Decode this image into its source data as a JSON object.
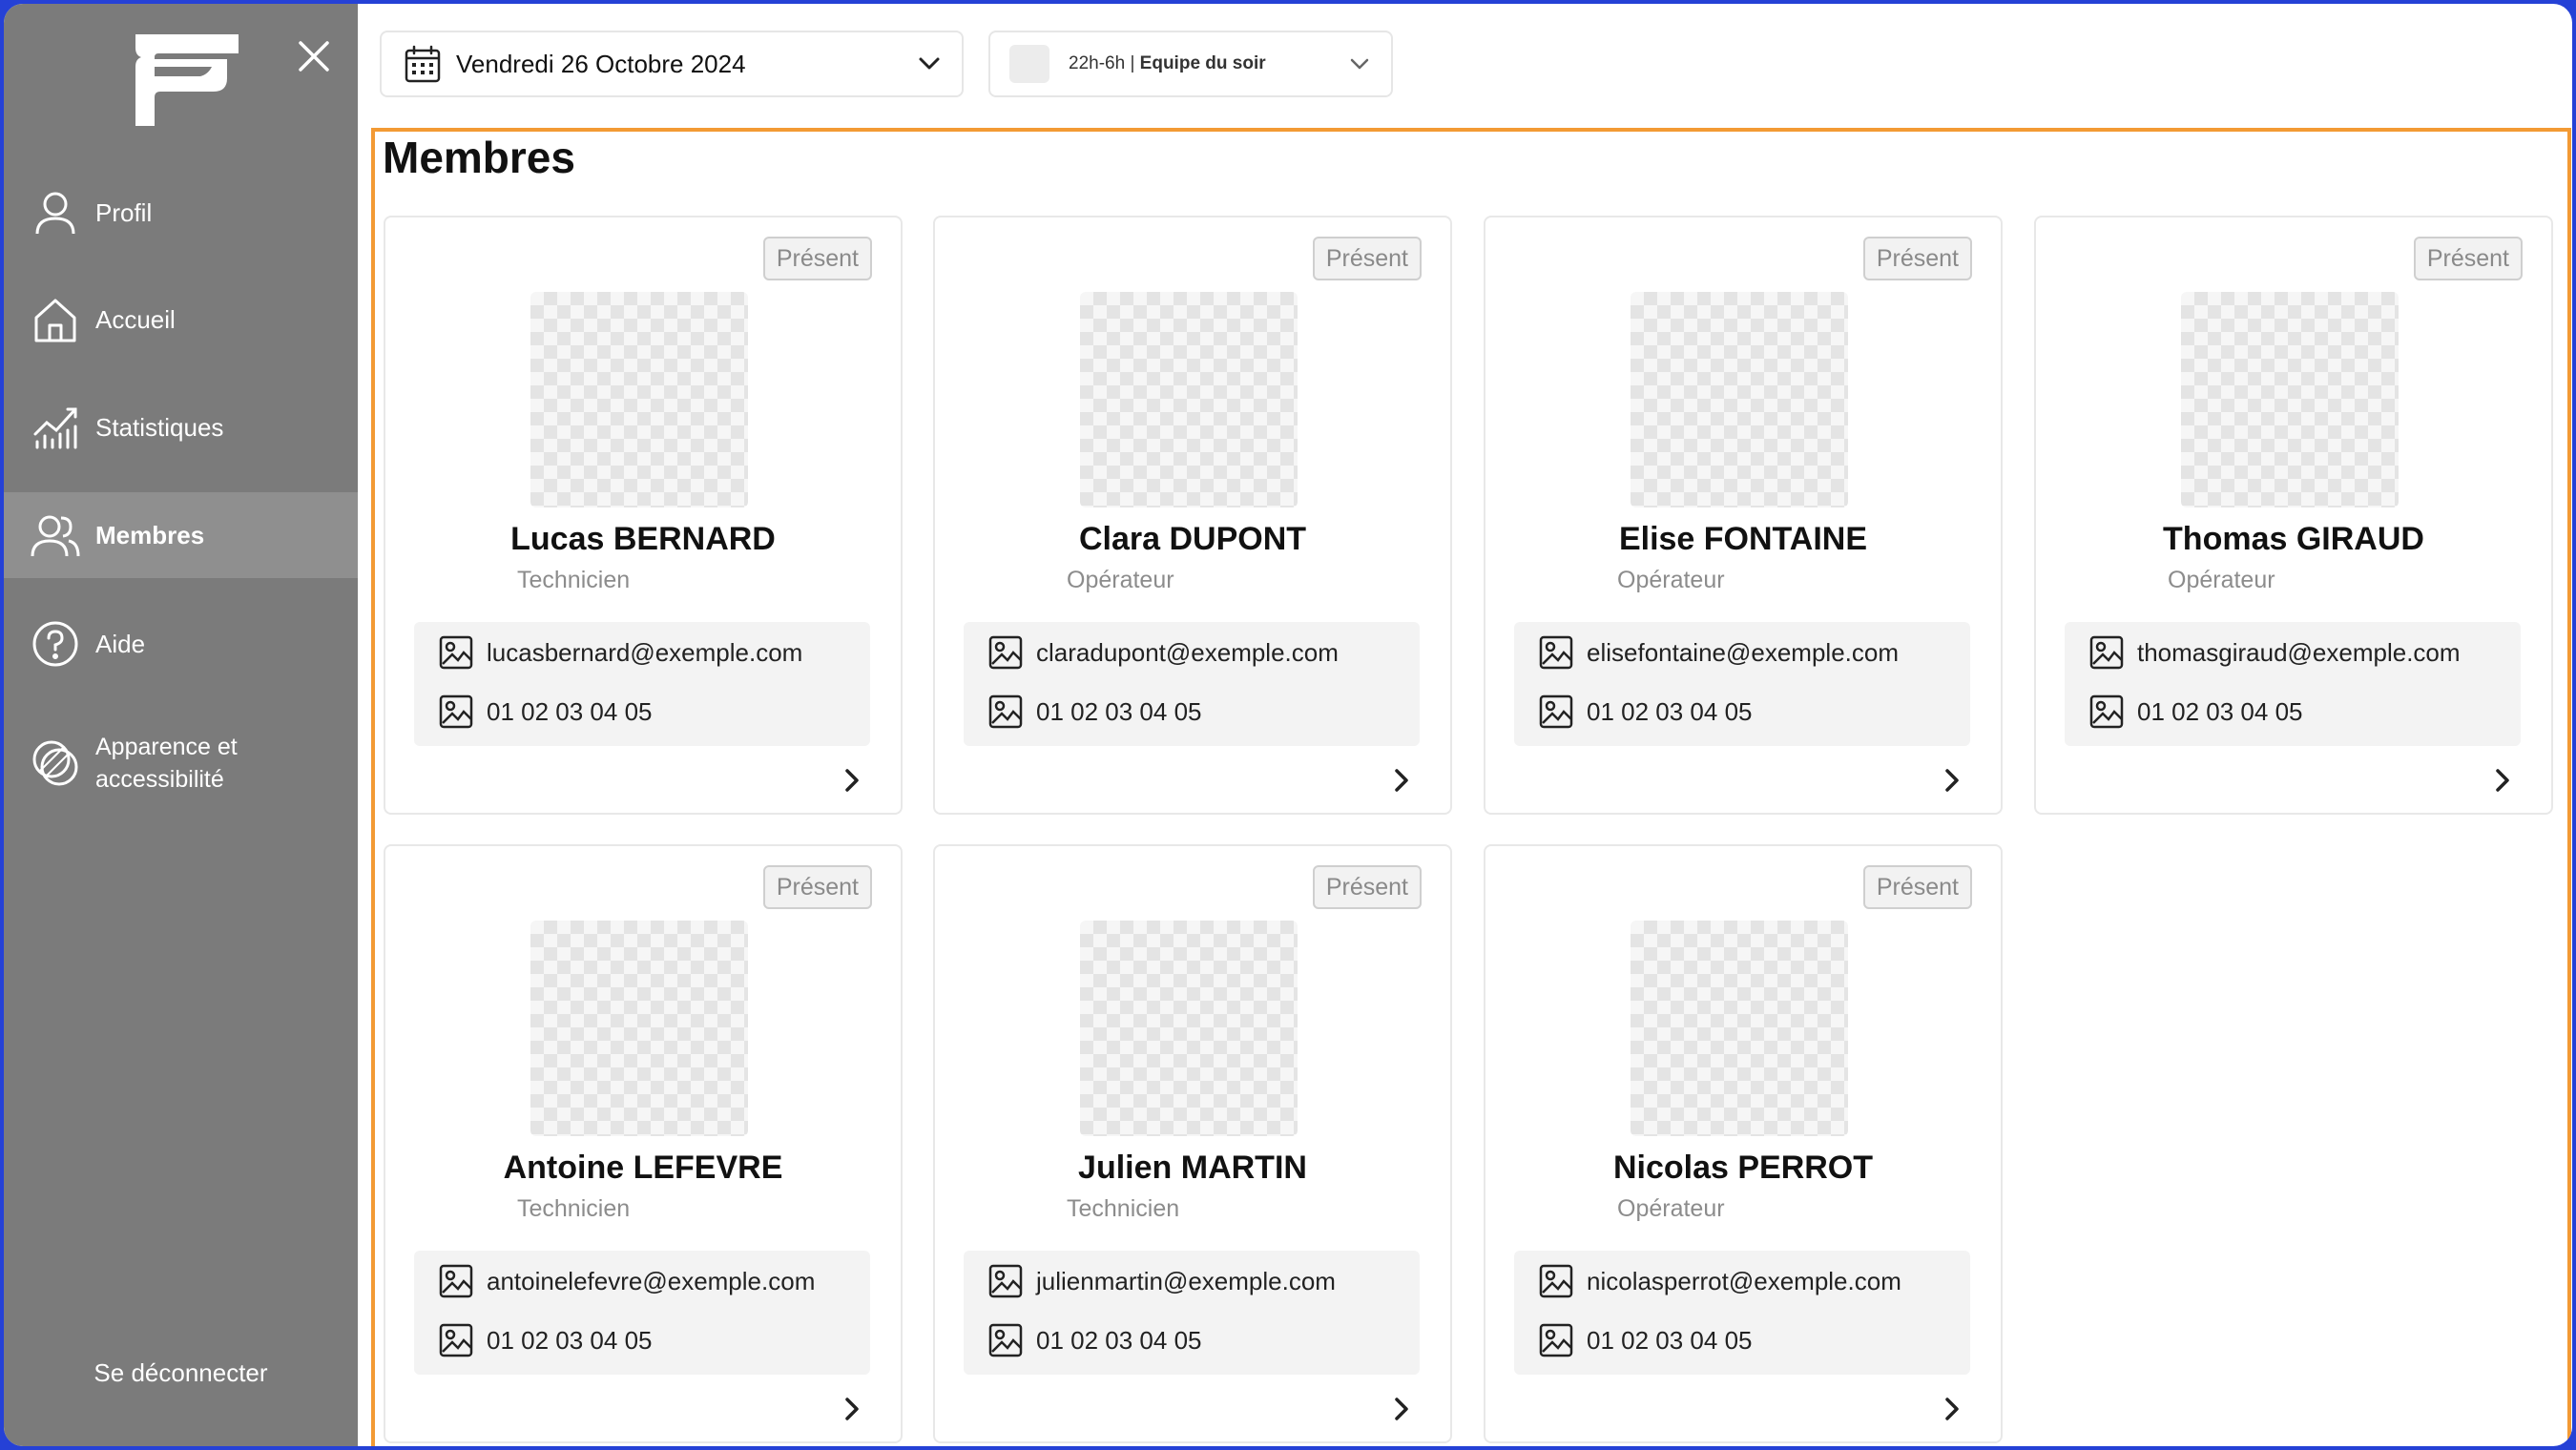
{
  "sidebar": {
    "items": [
      {
        "label": "Profil",
        "icon": "user-icon"
      },
      {
        "label": "Accueil",
        "icon": "home-icon"
      },
      {
        "label": "Statistiques",
        "icon": "chart-icon"
      },
      {
        "label": "Membres",
        "icon": "members-icon",
        "active": true
      },
      {
        "label": "Aide",
        "icon": "help-icon"
      },
      {
        "label": "Apparence et accessibilité",
        "icon": "appearance-icon"
      }
    ],
    "logout_label": "Se déconnecter"
  },
  "toolbar": {
    "date_label": "Vendredi 26 Octobre 2024",
    "shift_time": "22h-6h",
    "shift_team": "Equipe du soir"
  },
  "page": {
    "title": "Membres"
  },
  "members": [
    {
      "name": "Lucas BERNARD",
      "role": "Technicien",
      "email": "lucasbernard@exemple.com",
      "phone": "01 02 03 04 05",
      "status": "Présent"
    },
    {
      "name": "Clara DUPONT",
      "role": "Opérateur",
      "email": "claradupont@exemple.com",
      "phone": "01 02 03 04 05",
      "status": "Présent"
    },
    {
      "name": "Elise FONTAINE",
      "role": "Opérateur",
      "email": "elisefontaine@exemple.com",
      "phone": "01 02 03 04 05",
      "status": "Présent"
    },
    {
      "name": "Thomas GIRAUD",
      "role": "Opérateur",
      "email": "thomasgiraud@exemple.com",
      "phone": "01 02 03 04 05",
      "status": "Présent"
    },
    {
      "name": "Antoine LEFEVRE",
      "role": "Technicien",
      "email": "antoinelefevre@exemple.com",
      "phone": "01 02 03 04 05",
      "status": "Présent"
    },
    {
      "name": "Julien MARTIN",
      "role": "Technicien",
      "email": "julienmartin@exemple.com",
      "phone": "01 02 03 04 05",
      "status": "Présent"
    },
    {
      "name": "Nicolas PERROT",
      "role": "Opérateur",
      "email": "nicolasperrot@exemple.com",
      "phone": "01 02 03 04 05",
      "status": "Présent"
    }
  ],
  "colors": {
    "sidebar_bg": "#7b7b7b",
    "active_item_bg": "#8f8f8f",
    "content_border": "#f39a34",
    "outer_border": "#2541d6"
  }
}
